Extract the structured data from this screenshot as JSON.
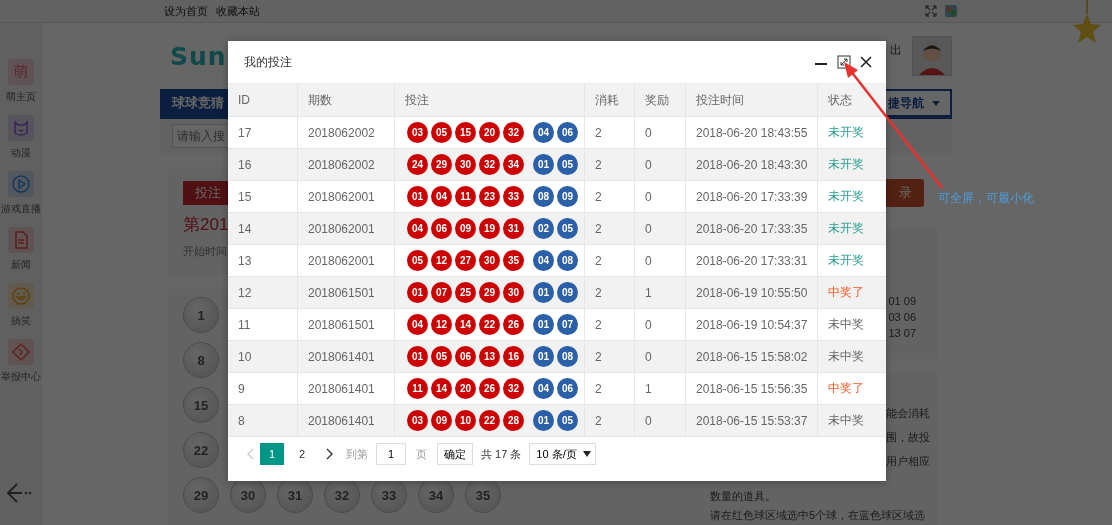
{
  "top_bar": {
    "links": [
      "设为首页",
      "收藏本站"
    ]
  },
  "sidebar": {
    "items": [
      {
        "label": "萌主页",
        "kind": "glyph",
        "glyph": "萌"
      },
      {
        "label": "动漫",
        "kind": "cat"
      },
      {
        "label": "游戏直播",
        "kind": "play"
      },
      {
        "label": "新闻",
        "kind": "doc"
      },
      {
        "label": "搞笑",
        "kind": "smile"
      },
      {
        "label": "举报中心",
        "kind": "diamond"
      }
    ]
  },
  "header": {
    "logo": "Sun",
    "logout": "出"
  },
  "nav": {
    "tab": "球球竞猜",
    "quick_nav": "捷导航"
  },
  "search": {
    "placeholder": "请输入搜"
  },
  "bet_card": {
    "badge": "投注",
    "title": "第201",
    "start": "开始时间"
  },
  "ball_rows": [
    [
      "1"
    ],
    [
      "8"
    ],
    [
      "15"
    ],
    [
      "22"
    ],
    [
      "29",
      "30",
      "31",
      "32",
      "33",
      "34",
      "35"
    ]
  ],
  "right_panel": {
    "record_button": "录",
    "numbers": [
      "01 09",
      "03 06",
      "13 07"
    ],
    "notes_cut": [
      "能会消耗",
      "围，故投",
      "用户相应"
    ],
    "notes": [
      "数量的道具。",
      "请在红色球区域选中5个球，在蓝色球区域选"
    ]
  },
  "modal": {
    "title": "我的投注",
    "columns": [
      "ID",
      "期数",
      "投注",
      "消耗",
      "奖励",
      "投注时间",
      "状态"
    ],
    "rows": [
      {
        "id": "17",
        "period": "2018062002",
        "red": [
          "03",
          "05",
          "15",
          "20",
          "32"
        ],
        "blue": [
          "04",
          "06"
        ],
        "cost": "2",
        "reward": "0",
        "time": "2018-06-20 18:43:55",
        "status": "未开奖",
        "kind": "pending"
      },
      {
        "id": "16",
        "period": "2018062002",
        "red": [
          "24",
          "29",
          "30",
          "32",
          "34"
        ],
        "blue": [
          "01",
          "05"
        ],
        "cost": "2",
        "reward": "0",
        "time": "2018-06-20 18:43:30",
        "status": "未开奖",
        "kind": "pending"
      },
      {
        "id": "15",
        "period": "2018062001",
        "red": [
          "01",
          "04",
          "11",
          "23",
          "33"
        ],
        "blue": [
          "08",
          "09"
        ],
        "cost": "2",
        "reward": "0",
        "time": "2018-06-20 17:33:39",
        "status": "未开奖",
        "kind": "pending"
      },
      {
        "id": "14",
        "period": "2018062001",
        "red": [
          "04",
          "06",
          "09",
          "19",
          "31"
        ],
        "blue": [
          "02",
          "05"
        ],
        "cost": "2",
        "reward": "0",
        "time": "2018-06-20 17:33:35",
        "status": "未开奖",
        "kind": "pending"
      },
      {
        "id": "13",
        "period": "2018062001",
        "red": [
          "05",
          "12",
          "27",
          "30",
          "35"
        ],
        "blue": [
          "04",
          "08"
        ],
        "cost": "2",
        "reward": "0",
        "time": "2018-06-20 17:33:31",
        "status": "未开奖",
        "kind": "pending"
      },
      {
        "id": "12",
        "period": "2018061501",
        "red": [
          "01",
          "07",
          "25",
          "29",
          "30"
        ],
        "blue": [
          "01",
          "09"
        ],
        "cost": "2",
        "reward": "1",
        "time": "2018-06-19 10:55:50",
        "status": "中奖了",
        "kind": "won"
      },
      {
        "id": "11",
        "period": "2018061501",
        "red": [
          "04",
          "12",
          "14",
          "22",
          "26"
        ],
        "blue": [
          "01",
          "07"
        ],
        "cost": "2",
        "reward": "0",
        "time": "2018-06-19 10:54:37",
        "status": "未中奖",
        "kind": "lost"
      },
      {
        "id": "10",
        "period": "2018061401",
        "red": [
          "01",
          "05",
          "06",
          "13",
          "16"
        ],
        "blue": [
          "01",
          "08"
        ],
        "cost": "2",
        "reward": "0",
        "time": "2018-06-15 15:58:02",
        "status": "未中奖",
        "kind": "lost"
      },
      {
        "id": "9",
        "period": "2018061401",
        "red": [
          "11",
          "14",
          "20",
          "26",
          "32"
        ],
        "blue": [
          "04",
          "06"
        ],
        "cost": "2",
        "reward": "1",
        "time": "2018-06-15 15:56:35",
        "status": "中奖了",
        "kind": "won"
      },
      {
        "id": "8",
        "period": "2018061401",
        "red": [
          "03",
          "09",
          "10",
          "22",
          "28"
        ],
        "blue": [
          "01",
          "05"
        ],
        "cost": "2",
        "reward": "0",
        "time": "2018-06-15 15:53:37",
        "status": "未中奖",
        "kind": "lost"
      }
    ],
    "pagination": {
      "pages": [
        {
          "label": "1",
          "selected": true
        },
        {
          "label": "2",
          "selected": false
        }
      ],
      "prev_disabled": true,
      "goto_label": "到第",
      "page_value": "1",
      "page_unit": "页",
      "confirm": "确定",
      "total": "共 17 条",
      "page_size": "10 条/页"
    }
  },
  "annotation": "可全屏，可最小化"
}
